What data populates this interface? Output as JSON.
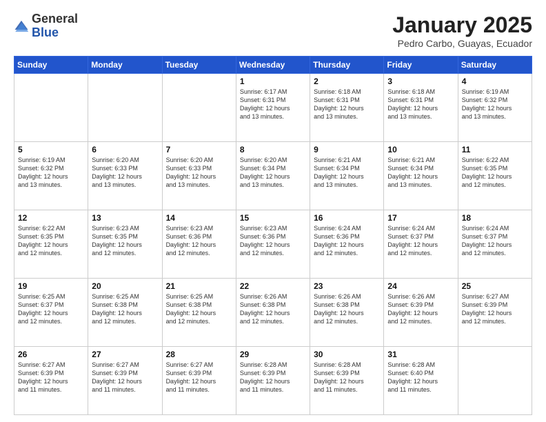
{
  "logo": {
    "general": "General",
    "blue": "Blue"
  },
  "title": {
    "month": "January 2025",
    "location": "Pedro Carbo, Guayas, Ecuador"
  },
  "weekdays": [
    "Sunday",
    "Monday",
    "Tuesday",
    "Wednesday",
    "Thursday",
    "Friday",
    "Saturday"
  ],
  "weeks": [
    [
      {
        "day": "",
        "info": ""
      },
      {
        "day": "",
        "info": ""
      },
      {
        "day": "",
        "info": ""
      },
      {
        "day": "1",
        "info": "Sunrise: 6:17 AM\nSunset: 6:31 PM\nDaylight: 12 hours\nand 13 minutes."
      },
      {
        "day": "2",
        "info": "Sunrise: 6:18 AM\nSunset: 6:31 PM\nDaylight: 12 hours\nand 13 minutes."
      },
      {
        "day": "3",
        "info": "Sunrise: 6:18 AM\nSunset: 6:31 PM\nDaylight: 12 hours\nand 13 minutes."
      },
      {
        "day": "4",
        "info": "Sunrise: 6:19 AM\nSunset: 6:32 PM\nDaylight: 12 hours\nand 13 minutes."
      }
    ],
    [
      {
        "day": "5",
        "info": "Sunrise: 6:19 AM\nSunset: 6:32 PM\nDaylight: 12 hours\nand 13 minutes."
      },
      {
        "day": "6",
        "info": "Sunrise: 6:20 AM\nSunset: 6:33 PM\nDaylight: 12 hours\nand 13 minutes."
      },
      {
        "day": "7",
        "info": "Sunrise: 6:20 AM\nSunset: 6:33 PM\nDaylight: 12 hours\nand 13 minutes."
      },
      {
        "day": "8",
        "info": "Sunrise: 6:20 AM\nSunset: 6:34 PM\nDaylight: 12 hours\nand 13 minutes."
      },
      {
        "day": "9",
        "info": "Sunrise: 6:21 AM\nSunset: 6:34 PM\nDaylight: 12 hours\nand 13 minutes."
      },
      {
        "day": "10",
        "info": "Sunrise: 6:21 AM\nSunset: 6:34 PM\nDaylight: 12 hours\nand 13 minutes."
      },
      {
        "day": "11",
        "info": "Sunrise: 6:22 AM\nSunset: 6:35 PM\nDaylight: 12 hours\nand 12 minutes."
      }
    ],
    [
      {
        "day": "12",
        "info": "Sunrise: 6:22 AM\nSunset: 6:35 PM\nDaylight: 12 hours\nand 12 minutes."
      },
      {
        "day": "13",
        "info": "Sunrise: 6:23 AM\nSunset: 6:35 PM\nDaylight: 12 hours\nand 12 minutes."
      },
      {
        "day": "14",
        "info": "Sunrise: 6:23 AM\nSunset: 6:36 PM\nDaylight: 12 hours\nand 12 minutes."
      },
      {
        "day": "15",
        "info": "Sunrise: 6:23 AM\nSunset: 6:36 PM\nDaylight: 12 hours\nand 12 minutes."
      },
      {
        "day": "16",
        "info": "Sunrise: 6:24 AM\nSunset: 6:36 PM\nDaylight: 12 hours\nand 12 minutes."
      },
      {
        "day": "17",
        "info": "Sunrise: 6:24 AM\nSunset: 6:37 PM\nDaylight: 12 hours\nand 12 minutes."
      },
      {
        "day": "18",
        "info": "Sunrise: 6:24 AM\nSunset: 6:37 PM\nDaylight: 12 hours\nand 12 minutes."
      }
    ],
    [
      {
        "day": "19",
        "info": "Sunrise: 6:25 AM\nSunset: 6:37 PM\nDaylight: 12 hours\nand 12 minutes."
      },
      {
        "day": "20",
        "info": "Sunrise: 6:25 AM\nSunset: 6:38 PM\nDaylight: 12 hours\nand 12 minutes."
      },
      {
        "day": "21",
        "info": "Sunrise: 6:25 AM\nSunset: 6:38 PM\nDaylight: 12 hours\nand 12 minutes."
      },
      {
        "day": "22",
        "info": "Sunrise: 6:26 AM\nSunset: 6:38 PM\nDaylight: 12 hours\nand 12 minutes."
      },
      {
        "day": "23",
        "info": "Sunrise: 6:26 AM\nSunset: 6:38 PM\nDaylight: 12 hours\nand 12 minutes."
      },
      {
        "day": "24",
        "info": "Sunrise: 6:26 AM\nSunset: 6:39 PM\nDaylight: 12 hours\nand 12 minutes."
      },
      {
        "day": "25",
        "info": "Sunrise: 6:27 AM\nSunset: 6:39 PM\nDaylight: 12 hours\nand 12 minutes."
      }
    ],
    [
      {
        "day": "26",
        "info": "Sunrise: 6:27 AM\nSunset: 6:39 PM\nDaylight: 12 hours\nand 11 minutes."
      },
      {
        "day": "27",
        "info": "Sunrise: 6:27 AM\nSunset: 6:39 PM\nDaylight: 12 hours\nand 11 minutes."
      },
      {
        "day": "28",
        "info": "Sunrise: 6:27 AM\nSunset: 6:39 PM\nDaylight: 12 hours\nand 11 minutes."
      },
      {
        "day": "29",
        "info": "Sunrise: 6:28 AM\nSunset: 6:39 PM\nDaylight: 12 hours\nand 11 minutes."
      },
      {
        "day": "30",
        "info": "Sunrise: 6:28 AM\nSunset: 6:39 PM\nDaylight: 12 hours\nand 11 minutes."
      },
      {
        "day": "31",
        "info": "Sunrise: 6:28 AM\nSunset: 6:40 PM\nDaylight: 12 hours\nand 11 minutes."
      },
      {
        "day": "",
        "info": ""
      }
    ]
  ]
}
